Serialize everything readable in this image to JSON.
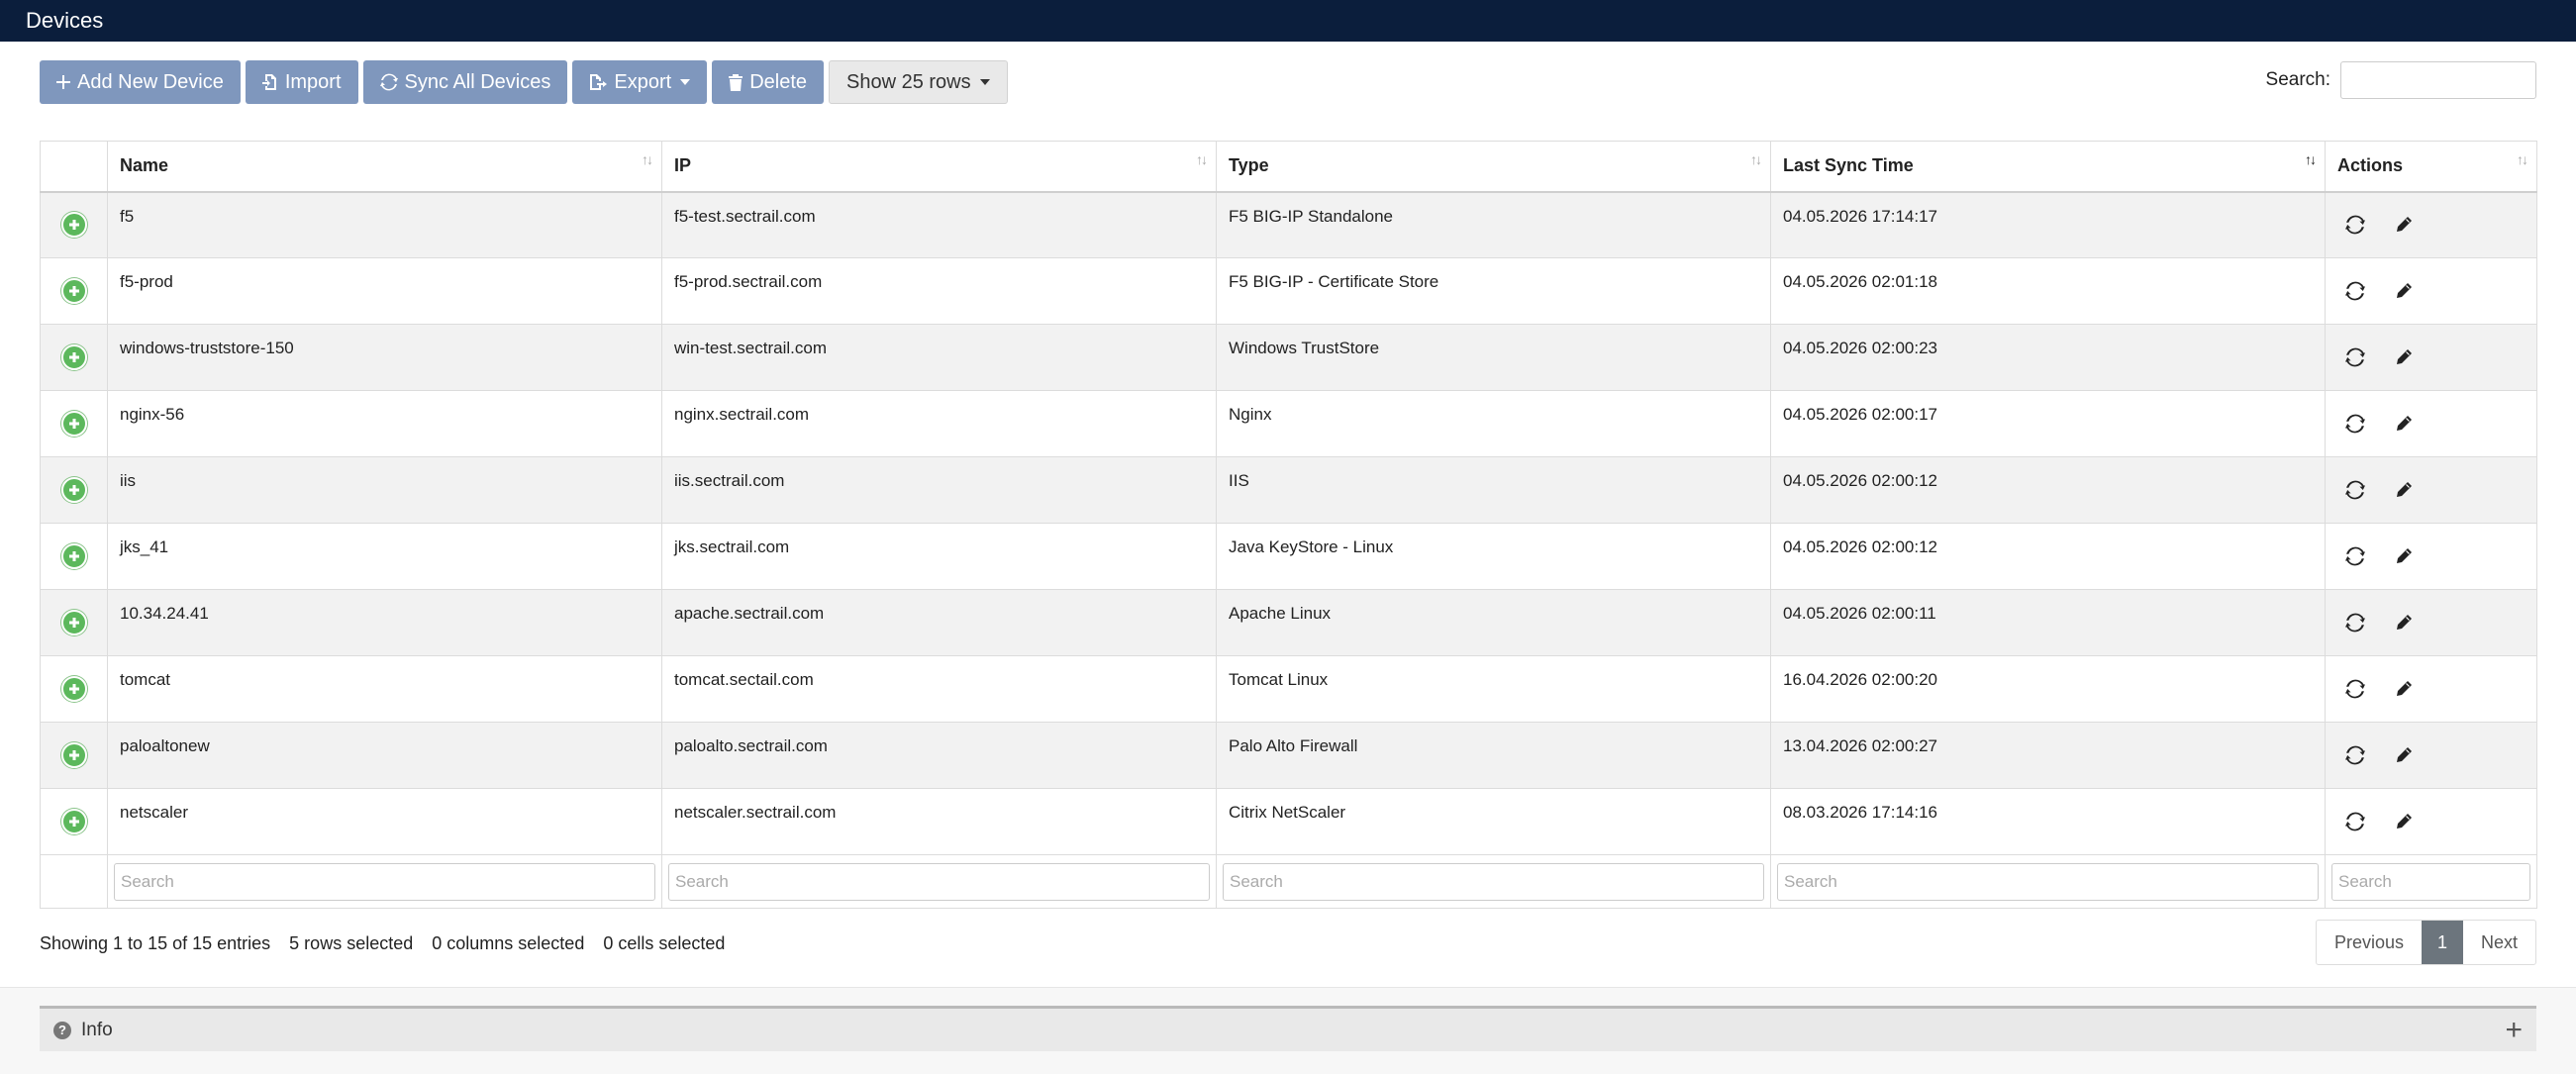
{
  "header": {
    "title": "Devices"
  },
  "toolbar": {
    "add": "Add New Device",
    "import": "Import",
    "sync_all": "Sync All Devices",
    "export": "Export",
    "delete": "Delete",
    "show_rows": "Show 25 rows"
  },
  "search": {
    "label": "Search:"
  },
  "table": {
    "columns": [
      "Name",
      "IP",
      "Type",
      "Last Sync Time",
      "Actions"
    ],
    "sorted_column": "Last Sync Time",
    "rows": [
      {
        "name": "f5",
        "ip": "f5-test.sectrail.com",
        "type": "F5 BIG-IP Standalone",
        "last_sync": "04.05.2026 17:14:17"
      },
      {
        "name": "f5-prod",
        "ip": "f5-prod.sectrail.com",
        "type": "F5 BIG-IP - Certificate Store",
        "last_sync": "04.05.2026 02:01:18"
      },
      {
        "name": "windows-truststore-150",
        "ip": "win-test.sectrail.com",
        "type": "Windows TrustStore",
        "last_sync": "04.05.2026 02:00:23"
      },
      {
        "name": "nginx-56",
        "ip": "nginx.sectrail.com",
        "type": "Nginx",
        "last_sync": "04.05.2026 02:00:17"
      },
      {
        "name": "iis",
        "ip": "iis.sectrail.com",
        "type": "IIS",
        "last_sync": "04.05.2026 02:00:12"
      },
      {
        "name": "jks_41",
        "ip": "jks.sectrail.com",
        "type": "Java KeyStore - Linux",
        "last_sync": "04.05.2026 02:00:12"
      },
      {
        "name": "10.34.24.41",
        "ip": "apache.sectrail.com",
        "type": "Apache Linux",
        "last_sync": "04.05.2026 02:00:11"
      },
      {
        "name": "tomcat",
        "ip": "tomcat.sectail.com",
        "type": "Tomcat Linux",
        "last_sync": "16.04.2026 02:00:20"
      },
      {
        "name": "paloaltonew",
        "ip": "paloalto.sectrail.com",
        "type": "Palo Alto Firewall",
        "last_sync": "13.04.2026 02:00:27"
      },
      {
        "name": "netscaler",
        "ip": "netscaler.sectrail.com",
        "type": "Citrix NetScaler",
        "last_sync": "08.03.2026 17:14:16"
      }
    ],
    "filter_placeholder": "Search"
  },
  "footer": {
    "showing": "Showing 1 to 15 of 15 entries",
    "rows_selected": "5 rows selected",
    "columns_selected": "0 columns selected",
    "cells_selected": "0 cells selected"
  },
  "pagination": {
    "previous": "Previous",
    "current": "1",
    "next": "Next"
  },
  "info_panel": {
    "title": "Info"
  },
  "colors": {
    "header_bg": "#0b1e3c",
    "button_bg": "#7f97bd",
    "add_icon": "#5cb85c"
  },
  "icons": {
    "row_expand": "plus-circle-icon",
    "sync": "sync-icon",
    "edit": "pencil-icon"
  }
}
